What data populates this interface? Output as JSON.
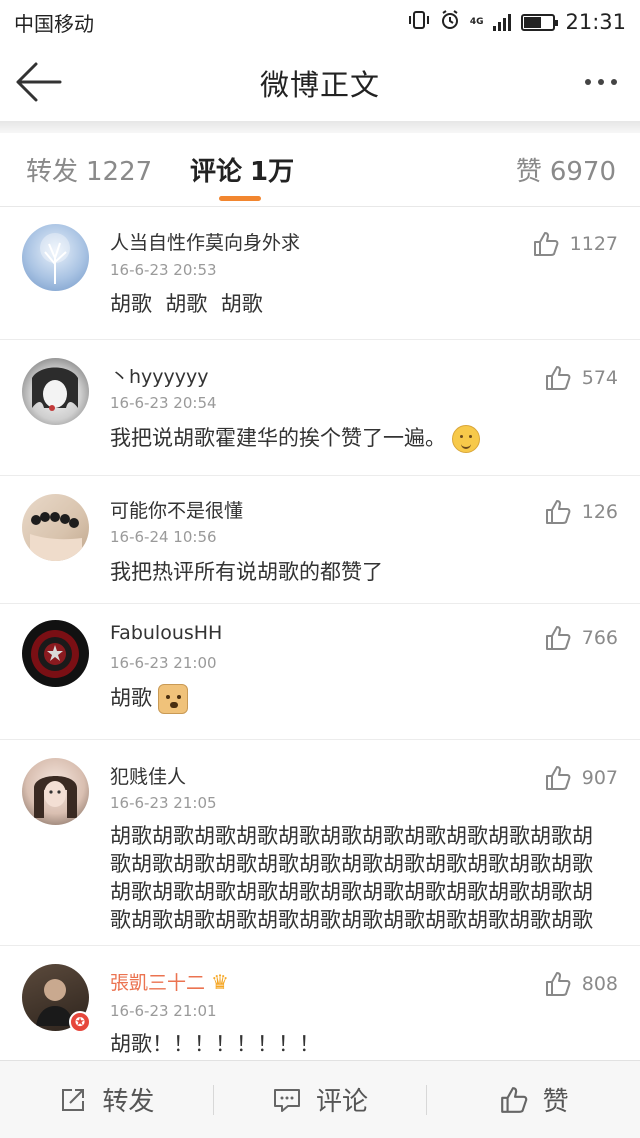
{
  "status_bar": {
    "carrier": "中国移动",
    "network": "4G",
    "time": "21:31",
    "battery_level": 0.6,
    "icons": [
      "vibrate-icon",
      "alarm-icon",
      "signal-icon",
      "battery-icon"
    ]
  },
  "nav": {
    "title": "微博正文",
    "back_icon": "arrow-left-icon",
    "more_icon": "more-dots-icon"
  },
  "tabs": {
    "repost": {
      "label": "转发",
      "count": "1227"
    },
    "comment": {
      "label": "评论",
      "count": "1万",
      "active": true
    },
    "like": {
      "label": "赞",
      "count": "6970"
    },
    "accent_color": "#f2862f"
  },
  "comments": [
    {
      "user": "人当自性作莫向身外求",
      "time": "16-6-23 20:53",
      "text": "胡歌 胡歌 胡歌",
      "likes": "1127"
    },
    {
      "user": "丶hyyyyyy",
      "time": "16-6-23 20:54",
      "text": "我把说胡歌霍建华的挨个赞了一遍。",
      "likes": "574",
      "emoji": "smiling-face"
    },
    {
      "user": "可能你不是很懂",
      "time": "16-6-24 10:56",
      "text": "我把热评所有说胡歌的都赞了",
      "likes": "126"
    },
    {
      "user": "FabulousHH",
      "time": "16-6-23 21:00",
      "text": "胡歌",
      "likes": "766",
      "emoji": "doge"
    },
    {
      "user": "犯贱佳人",
      "time": "16-6-23 21:05",
      "text": "胡歌胡歌胡歌胡歌胡歌胡歌胡歌胡歌胡歌胡歌胡歌胡歌胡歌胡歌胡歌胡歌胡歌胡歌胡歌胡歌胡歌胡歌胡歌胡歌胡歌胡歌胡歌胡歌胡歌胡歌胡歌胡歌胡歌胡歌胡歌胡歌胡歌胡歌胡歌胡歌胡歌胡歌胡歌胡歌胡歌胡歌",
      "likes": "907"
    },
    {
      "user": "張凱三十二",
      "time": "16-6-23 21:01",
      "text": "胡歌！！！！！！！！",
      "likes": "808",
      "vip": true,
      "badge": "crown"
    }
  ],
  "bottom_bar": {
    "repost_label": "转发",
    "comment_label": "评论",
    "like_label": "赞"
  }
}
